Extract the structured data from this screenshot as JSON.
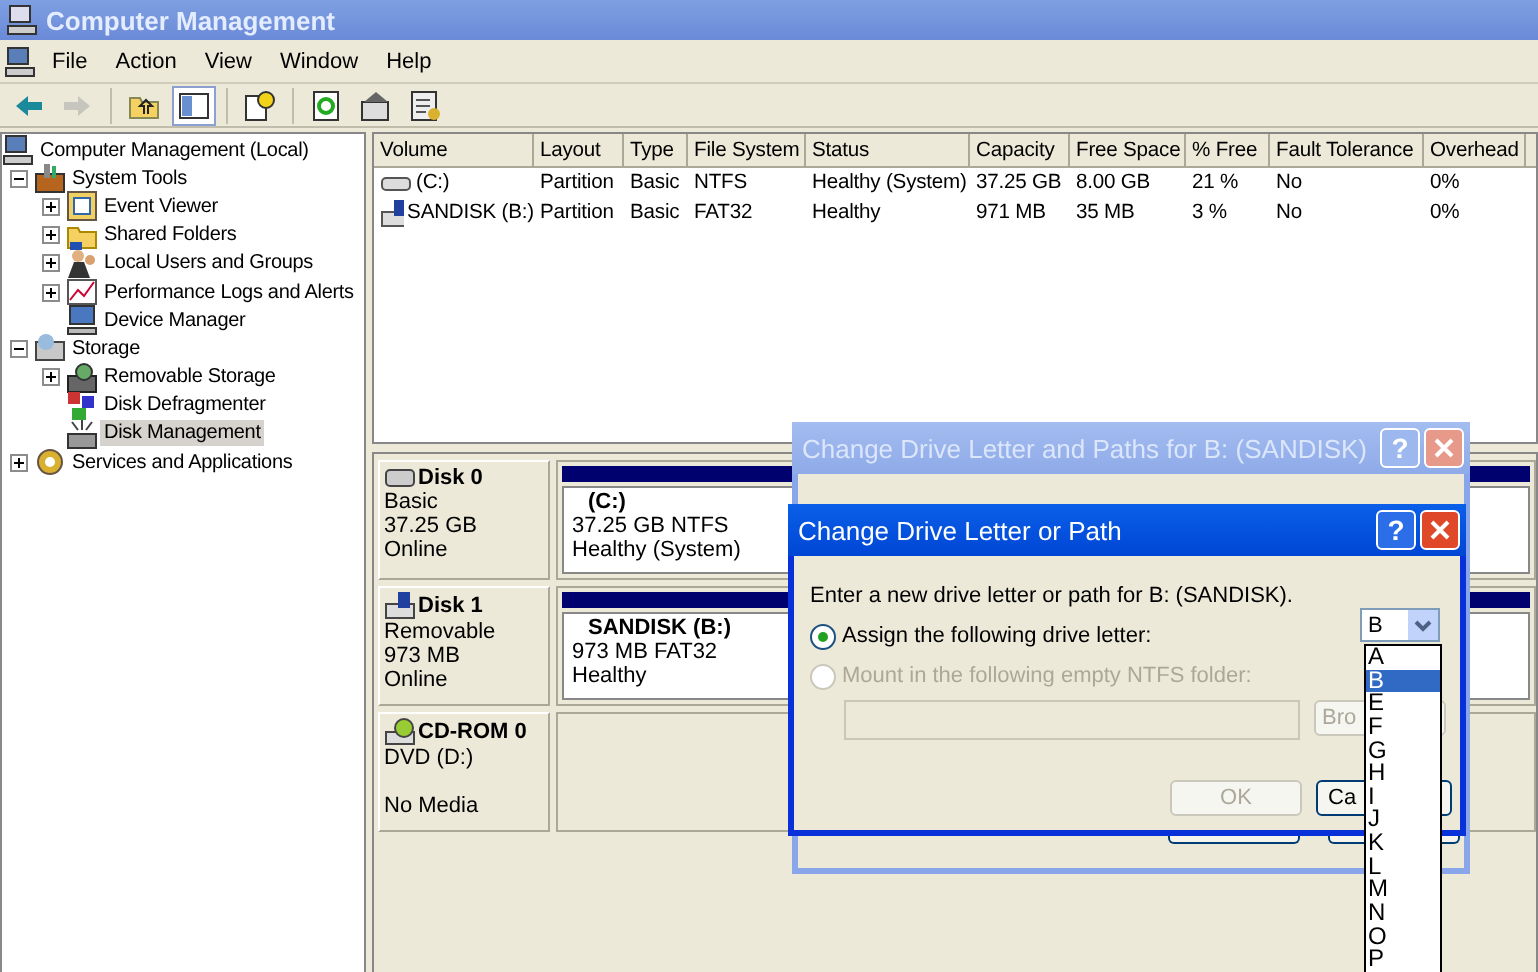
{
  "window": {
    "title": "Computer Management"
  },
  "menu": [
    "File",
    "Action",
    "View",
    "Window",
    "Help"
  ],
  "toolbar": [
    {
      "kind": "back",
      "disabled": false,
      "pressed": false
    },
    {
      "kind": "forward",
      "disabled": true,
      "pressed": false
    },
    {
      "kind": "up",
      "disabled": false,
      "pressed": false
    },
    {
      "kind": "tree",
      "disabled": false,
      "pressed": true
    },
    {
      "kind": "help",
      "disabled": false,
      "pressed": false
    },
    {
      "kind": "refresh",
      "disabled": false,
      "pressed": false
    },
    {
      "kind": "properties",
      "disabled": false,
      "pressed": false
    },
    {
      "kind": "export",
      "disabled": false,
      "pressed": false
    }
  ],
  "tree": [
    {
      "label": "Computer Management (Local)",
      "kind": "computer",
      "selected": false,
      "children": [
        {
          "label": "System Tools",
          "kind": "tools",
          "expandable": true,
          "expanded": true,
          "selected": false,
          "children": [
            {
              "label": "Event Viewer",
              "kind": "event",
              "expandable": true,
              "expanded": false,
              "selected": false
            },
            {
              "label": "Shared Folders",
              "kind": "folder",
              "expandable": true,
              "expanded": false,
              "selected": false
            },
            {
              "label": "Local Users and Groups",
              "kind": "users",
              "expandable": true,
              "expanded": false,
              "selected": false
            },
            {
              "label": "Performance Logs and Alerts",
              "kind": "perf",
              "expandable": true,
              "expanded": false,
              "selected": false
            },
            {
              "label": "Device Manager",
              "kind": "device",
              "expandable": false,
              "selected": false
            }
          ]
        },
        {
          "label": "Storage",
          "kind": "storage",
          "expandable": true,
          "expanded": true,
          "selected": false,
          "children": [
            {
              "label": "Removable Storage",
              "kind": "removable",
              "expandable": true,
              "expanded": false,
              "selected": false
            },
            {
              "label": "Disk Defragmenter",
              "kind": "defrag",
              "expandable": false,
              "selected": false
            },
            {
              "label": "Disk Management",
              "kind": "diskmgmt",
              "expandable": false,
              "selected": true
            }
          ]
        },
        {
          "label": "Services and Applications",
          "kind": "services",
          "expandable": true,
          "expanded": false,
          "selected": false
        }
      ]
    }
  ],
  "volumes": {
    "columns": [
      "Volume",
      "Layout",
      "Type",
      "File System",
      "Status",
      "Capacity",
      "Free Space",
      "% Free",
      "Fault Tolerance",
      "Overhead"
    ],
    "rows": [
      {
        "kind": "fixed",
        "cells": [
          "(C:)",
          "Partition",
          "Basic",
          "NTFS",
          "Healthy (System)",
          "37.25 GB",
          "8.00 GB",
          "21 %",
          "No",
          "0%"
        ]
      },
      {
        "kind": "removable",
        "cells": [
          "SANDISK (B:)",
          "Partition",
          "Basic",
          "FAT32",
          "Healthy",
          "971 MB",
          "35 MB",
          "3 %",
          "No",
          "0%"
        ]
      }
    ]
  },
  "disks": [
    {
      "kind": "disk",
      "name": "Disk 0",
      "type": "Basic",
      "size": "37.25 GB",
      "status": "Online",
      "partition": {
        "name": "(C:)",
        "detail": "37.25 GB NTFS",
        "status": "Healthy (System)"
      }
    },
    {
      "kind": "removable",
      "name": "Disk 1",
      "type": "Removable",
      "size": "973 MB",
      "status": "Online",
      "partition": {
        "name": "SANDISK  (B:)",
        "detail": "973 MB FAT32",
        "status": "Healthy"
      }
    },
    {
      "kind": "cdrom",
      "name": "CD-ROM 0",
      "type": "DVD (D:)",
      "status": "No Media"
    }
  ],
  "back_dialog": {
    "title": "Change Drive Letter and Paths for B: (SANDISK)",
    "help": "?"
  },
  "dialog": {
    "title": "Change Drive Letter or Path",
    "help": "?",
    "prompt": "Enter a new drive letter or path for B: (SANDISK).",
    "options": [
      {
        "label": "Assign the following drive letter:",
        "selected": true,
        "disabled": false
      },
      {
        "label": "Mount in the following empty NTFS folder:",
        "selected": false,
        "disabled": true
      }
    ],
    "folder_field": {
      "disabled": true
    },
    "browse": {
      "label": "Bro",
      "disabled": true
    },
    "ok": {
      "label": "OK",
      "disabled": true
    },
    "cancel": {
      "label": "Ca",
      "disabled": false
    },
    "drive_letter": {
      "value": "B",
      "open": true
    },
    "letters": [
      {
        "label": "A",
        "selected": false
      },
      {
        "label": "B",
        "selected": true
      },
      {
        "label": "E",
        "selected": false
      },
      {
        "label": "F",
        "selected": false
      },
      {
        "label": "G",
        "selected": false
      },
      {
        "label": "H",
        "selected": false
      },
      {
        "label": "I",
        "selected": false
      },
      {
        "label": "J",
        "selected": false
      },
      {
        "label": "K",
        "selected": false
      },
      {
        "label": "L",
        "selected": false
      },
      {
        "label": "M",
        "selected": false
      },
      {
        "label": "N",
        "selected": false
      },
      {
        "label": "O",
        "selected": false
      },
      {
        "label": "P",
        "selected": false
      }
    ]
  }
}
